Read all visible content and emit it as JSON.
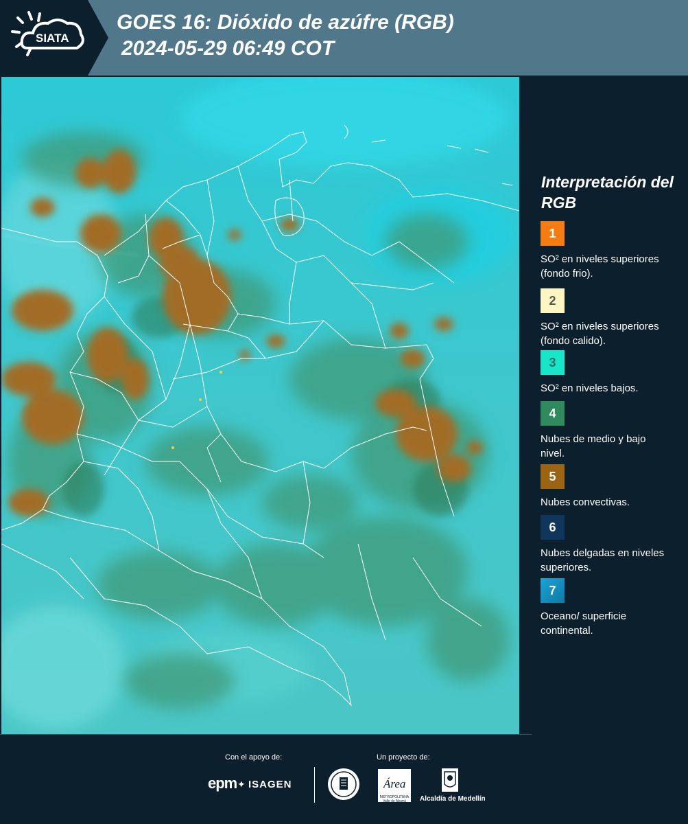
{
  "header": {
    "logo_text": "SIATA",
    "title_line1": "GOES 16: Dióxido de azúfre (RGB)",
    "title_line2": "2024-05-29 06:49 COT",
    "background_color": "#51788a"
  },
  "legend": {
    "title": "Interpretación del RGB",
    "items": [
      {
        "number": "1",
        "label": "SO² en niveles superiores (fondo frio).",
        "color": "#f47c12",
        "number_color": "#ffffff"
      },
      {
        "number": "2",
        "label": "SO² en niveles superiores (fondo calido).",
        "color": "#fdf6c3",
        "number_color": "#555555"
      },
      {
        "number": "3",
        "label": "SO² en niveles bajos.",
        "color": "#19e6c8",
        "number_color": "#2a6b66"
      },
      {
        "number": "4",
        "label": "Nubes de medio y bajo nivel.",
        "color": "#2e8a5d",
        "number_color": "#ffffff"
      },
      {
        "number": "5",
        "label": "Nubes convectivas.",
        "color": "#9b6412",
        "number_color": "#ffffff"
      },
      {
        "number": "6",
        "label": "Nubes delgadas en niveles superiores.",
        "color": "#10365e",
        "number_color": "#ffffff"
      },
      {
        "number": "7",
        "label": "Oceano/ superficie continental.",
        "color": "#1a8fc4",
        "number_color": "#ffffff"
      }
    ]
  },
  "footer": {
    "support_text": "Con el apoyo de:",
    "project_text": "Un proyecto de:",
    "epm_text": "epm",
    "isagen_text": "ISAGEN",
    "area_text": "Área",
    "area_caption": "METROPOLITANA Valle de Aburrá",
    "alcaldia_text": "Alcaldía de Medellín"
  }
}
